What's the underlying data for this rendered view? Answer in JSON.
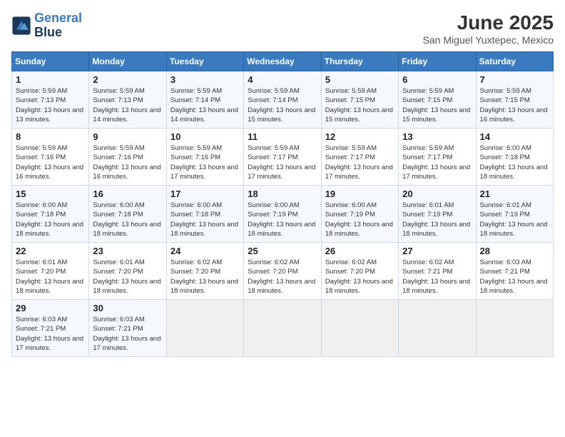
{
  "logo": {
    "line1": "General",
    "line2": "Blue"
  },
  "title": {
    "month_year": "June 2025",
    "location": "San Miguel Yuxtepec, Mexico"
  },
  "days_of_week": [
    "Sunday",
    "Monday",
    "Tuesday",
    "Wednesday",
    "Thursday",
    "Friday",
    "Saturday"
  ],
  "weeks": [
    [
      {
        "day": "1",
        "sunrise": "5:59 AM",
        "sunset": "7:13 PM",
        "daylight": "13 hours and 13 minutes."
      },
      {
        "day": "2",
        "sunrise": "5:59 AM",
        "sunset": "7:13 PM",
        "daylight": "13 hours and 14 minutes."
      },
      {
        "day": "3",
        "sunrise": "5:59 AM",
        "sunset": "7:14 PM",
        "daylight": "13 hours and 14 minutes."
      },
      {
        "day": "4",
        "sunrise": "5:59 AM",
        "sunset": "7:14 PM",
        "daylight": "13 hours and 15 minutes."
      },
      {
        "day": "5",
        "sunrise": "5:59 AM",
        "sunset": "7:15 PM",
        "daylight": "13 hours and 15 minutes."
      },
      {
        "day": "6",
        "sunrise": "5:59 AM",
        "sunset": "7:15 PM",
        "daylight": "13 hours and 15 minutes."
      },
      {
        "day": "7",
        "sunrise": "5:59 AM",
        "sunset": "7:15 PM",
        "daylight": "13 hours and 16 minutes."
      }
    ],
    [
      {
        "day": "8",
        "sunrise": "5:59 AM",
        "sunset": "7:16 PM",
        "daylight": "13 hours and 16 minutes."
      },
      {
        "day": "9",
        "sunrise": "5:59 AM",
        "sunset": "7:16 PM",
        "daylight": "13 hours and 16 minutes."
      },
      {
        "day": "10",
        "sunrise": "5:59 AM",
        "sunset": "7:16 PM",
        "daylight": "13 hours and 17 minutes."
      },
      {
        "day": "11",
        "sunrise": "5:59 AM",
        "sunset": "7:17 PM",
        "daylight": "13 hours and 17 minutes."
      },
      {
        "day": "12",
        "sunrise": "5:59 AM",
        "sunset": "7:17 PM",
        "daylight": "13 hours and 17 minutes."
      },
      {
        "day": "13",
        "sunrise": "5:59 AM",
        "sunset": "7:17 PM",
        "daylight": "13 hours and 17 minutes."
      },
      {
        "day": "14",
        "sunrise": "6:00 AM",
        "sunset": "7:18 PM",
        "daylight": "13 hours and 18 minutes."
      }
    ],
    [
      {
        "day": "15",
        "sunrise": "6:00 AM",
        "sunset": "7:18 PM",
        "daylight": "13 hours and 18 minutes."
      },
      {
        "day": "16",
        "sunrise": "6:00 AM",
        "sunset": "7:18 PM",
        "daylight": "13 hours and 18 minutes."
      },
      {
        "day": "17",
        "sunrise": "6:00 AM",
        "sunset": "7:18 PM",
        "daylight": "13 hours and 18 minutes."
      },
      {
        "day": "18",
        "sunrise": "6:00 AM",
        "sunset": "7:19 PM",
        "daylight": "13 hours and 18 minutes."
      },
      {
        "day": "19",
        "sunrise": "6:00 AM",
        "sunset": "7:19 PM",
        "daylight": "13 hours and 18 minutes."
      },
      {
        "day": "20",
        "sunrise": "6:01 AM",
        "sunset": "7:19 PM",
        "daylight": "13 hours and 18 minutes."
      },
      {
        "day": "21",
        "sunrise": "6:01 AM",
        "sunset": "7:19 PM",
        "daylight": "13 hours and 18 minutes."
      }
    ],
    [
      {
        "day": "22",
        "sunrise": "6:01 AM",
        "sunset": "7:20 PM",
        "daylight": "13 hours and 18 minutes."
      },
      {
        "day": "23",
        "sunrise": "6:01 AM",
        "sunset": "7:20 PM",
        "daylight": "13 hours and 18 minutes."
      },
      {
        "day": "24",
        "sunrise": "6:02 AM",
        "sunset": "7:20 PM",
        "daylight": "13 hours and 18 minutes."
      },
      {
        "day": "25",
        "sunrise": "6:02 AM",
        "sunset": "7:20 PM",
        "daylight": "13 hours and 18 minutes."
      },
      {
        "day": "26",
        "sunrise": "6:02 AM",
        "sunset": "7:20 PM",
        "daylight": "13 hours and 18 minutes."
      },
      {
        "day": "27",
        "sunrise": "6:02 AM",
        "sunset": "7:21 PM",
        "daylight": "13 hours and 18 minutes."
      },
      {
        "day": "28",
        "sunrise": "6:03 AM",
        "sunset": "7:21 PM",
        "daylight": "13 hours and 18 minutes."
      }
    ],
    [
      {
        "day": "29",
        "sunrise": "6:03 AM",
        "sunset": "7:21 PM",
        "daylight": "13 hours and 17 minutes."
      },
      {
        "day": "30",
        "sunrise": "6:03 AM",
        "sunset": "7:21 PM",
        "daylight": "13 hours and 17 minutes."
      },
      null,
      null,
      null,
      null,
      null
    ]
  ]
}
